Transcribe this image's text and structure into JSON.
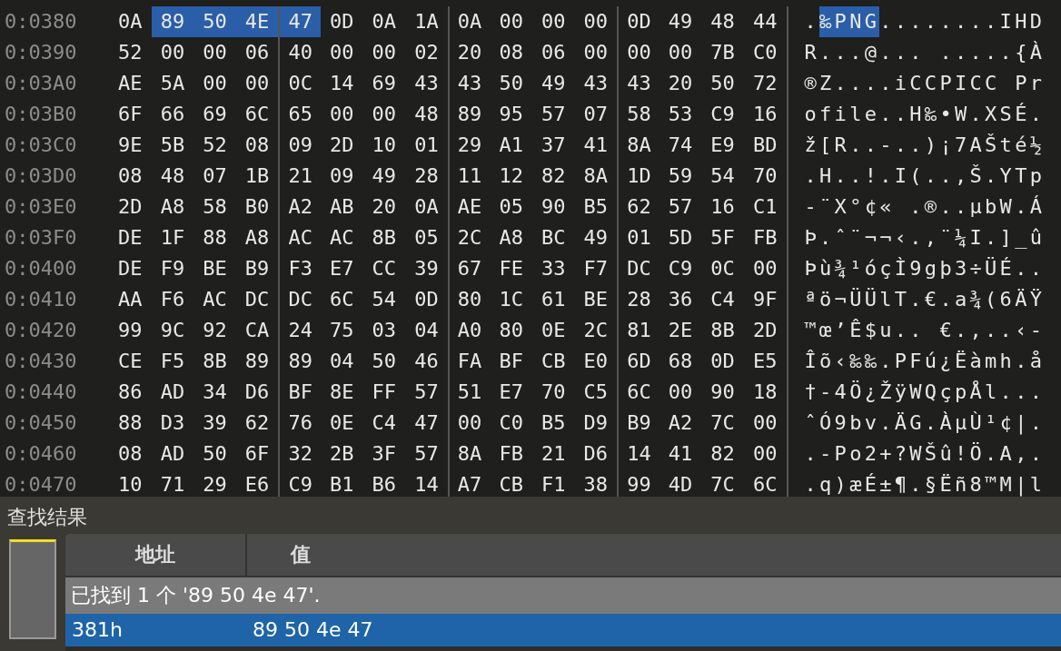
{
  "hex_view": {
    "rows": [
      {
        "offset": "0:0380",
        "bytes": [
          {
            "hex": "0A",
            "selected": false
          },
          {
            "hex": "89",
            "selected": true
          },
          {
            "hex": "50",
            "selected": true
          },
          {
            "hex": "4E",
            "selected": true
          },
          {
            "hex": "47",
            "selected": true
          },
          {
            "hex": "0D",
            "selected": false
          },
          {
            "hex": "0A",
            "selected": false
          },
          {
            "hex": "1A",
            "selected": false
          },
          {
            "hex": "0A",
            "selected": false
          },
          {
            "hex": "00",
            "selected": false
          },
          {
            "hex": "00",
            "selected": false
          },
          {
            "hex": "00",
            "selected": false
          },
          {
            "hex": "0D",
            "selected": false
          },
          {
            "hex": "49",
            "selected": false
          },
          {
            "hex": "48",
            "selected": false
          },
          {
            "hex": "44",
            "selected": false
          }
        ],
        "ascii": [
          {
            "text": ".",
            "selected": false
          },
          {
            "text": "‰PNG",
            "selected": true
          },
          {
            "text": "........IHD",
            "selected": false
          }
        ]
      },
      {
        "offset": "0:0390",
        "bytes": [
          {
            "hex": "52",
            "selected": false
          },
          {
            "hex": "00",
            "selected": false
          },
          {
            "hex": "00",
            "selected": false
          },
          {
            "hex": "06",
            "selected": false
          },
          {
            "hex": "40",
            "selected": false
          },
          {
            "hex": "00",
            "selected": false
          },
          {
            "hex": "00",
            "selected": false
          },
          {
            "hex": "02",
            "selected": false
          },
          {
            "hex": "20",
            "selected": false
          },
          {
            "hex": "08",
            "selected": false
          },
          {
            "hex": "06",
            "selected": false
          },
          {
            "hex": "00",
            "selected": false
          },
          {
            "hex": "00",
            "selected": false
          },
          {
            "hex": "00",
            "selected": false
          },
          {
            "hex": "7B",
            "selected": false
          },
          {
            "hex": "C0",
            "selected": false
          }
        ],
        "ascii": [
          {
            "text": "R...@... .....{À",
            "selected": false
          }
        ]
      },
      {
        "offset": "0:03A0",
        "bytes": [
          {
            "hex": "AE",
            "selected": false
          },
          {
            "hex": "5A",
            "selected": false
          },
          {
            "hex": "00",
            "selected": false
          },
          {
            "hex": "00",
            "selected": false
          },
          {
            "hex": "0C",
            "selected": false
          },
          {
            "hex": "14",
            "selected": false
          },
          {
            "hex": "69",
            "selected": false
          },
          {
            "hex": "43",
            "selected": false
          },
          {
            "hex": "43",
            "selected": false
          },
          {
            "hex": "50",
            "selected": false
          },
          {
            "hex": "49",
            "selected": false
          },
          {
            "hex": "43",
            "selected": false
          },
          {
            "hex": "43",
            "selected": false
          },
          {
            "hex": "20",
            "selected": false
          },
          {
            "hex": "50",
            "selected": false
          },
          {
            "hex": "72",
            "selected": false
          }
        ],
        "ascii": [
          {
            "text": "®Z....iCCPICC Pr",
            "selected": false
          }
        ]
      },
      {
        "offset": "0:03B0",
        "bytes": [
          {
            "hex": "6F",
            "selected": false
          },
          {
            "hex": "66",
            "selected": false
          },
          {
            "hex": "69",
            "selected": false
          },
          {
            "hex": "6C",
            "selected": false
          },
          {
            "hex": "65",
            "selected": false
          },
          {
            "hex": "00",
            "selected": false
          },
          {
            "hex": "00",
            "selected": false
          },
          {
            "hex": "48",
            "selected": false
          },
          {
            "hex": "89",
            "selected": false
          },
          {
            "hex": "95",
            "selected": false
          },
          {
            "hex": "57",
            "selected": false
          },
          {
            "hex": "07",
            "selected": false
          },
          {
            "hex": "58",
            "selected": false
          },
          {
            "hex": "53",
            "selected": false
          },
          {
            "hex": "C9",
            "selected": false
          },
          {
            "hex": "16",
            "selected": false
          }
        ],
        "ascii": [
          {
            "text": "ofile..H‰•W.XSÉ.",
            "selected": false
          }
        ]
      },
      {
        "offset": "0:03C0",
        "bytes": [
          {
            "hex": "9E",
            "selected": false
          },
          {
            "hex": "5B",
            "selected": false
          },
          {
            "hex": "52",
            "selected": false
          },
          {
            "hex": "08",
            "selected": false
          },
          {
            "hex": "09",
            "selected": false
          },
          {
            "hex": "2D",
            "selected": false
          },
          {
            "hex": "10",
            "selected": false
          },
          {
            "hex": "01",
            "selected": false
          },
          {
            "hex": "29",
            "selected": false
          },
          {
            "hex": "A1",
            "selected": false
          },
          {
            "hex": "37",
            "selected": false
          },
          {
            "hex": "41",
            "selected": false
          },
          {
            "hex": "8A",
            "selected": false
          },
          {
            "hex": "74",
            "selected": false
          },
          {
            "hex": "E9",
            "selected": false
          },
          {
            "hex": "BD",
            "selected": false
          }
        ],
        "ascii": [
          {
            "text": "ž[R..-..)¡7AŠté½",
            "selected": false
          }
        ]
      },
      {
        "offset": "0:03D0",
        "bytes": [
          {
            "hex": "08",
            "selected": false
          },
          {
            "hex": "48",
            "selected": false
          },
          {
            "hex": "07",
            "selected": false
          },
          {
            "hex": "1B",
            "selected": false
          },
          {
            "hex": "21",
            "selected": false
          },
          {
            "hex": "09",
            "selected": false
          },
          {
            "hex": "49",
            "selected": false
          },
          {
            "hex": "28",
            "selected": false
          },
          {
            "hex": "11",
            "selected": false
          },
          {
            "hex": "12",
            "selected": false
          },
          {
            "hex": "82",
            "selected": false
          },
          {
            "hex": "8A",
            "selected": false
          },
          {
            "hex": "1D",
            "selected": false
          },
          {
            "hex": "59",
            "selected": false
          },
          {
            "hex": "54",
            "selected": false
          },
          {
            "hex": "70",
            "selected": false
          }
        ],
        "ascii": [
          {
            "text": ".H..!.I(..,Š.YTp",
            "selected": false
          }
        ]
      },
      {
        "offset": "0:03E0",
        "bytes": [
          {
            "hex": "2D",
            "selected": false
          },
          {
            "hex": "A8",
            "selected": false
          },
          {
            "hex": "58",
            "selected": false
          },
          {
            "hex": "B0",
            "selected": false
          },
          {
            "hex": "A2",
            "selected": false
          },
          {
            "hex": "AB",
            "selected": false
          },
          {
            "hex": "20",
            "selected": false
          },
          {
            "hex": "0A",
            "selected": false
          },
          {
            "hex": "AE",
            "selected": false
          },
          {
            "hex": "05",
            "selected": false
          },
          {
            "hex": "90",
            "selected": false
          },
          {
            "hex": "B5",
            "selected": false
          },
          {
            "hex": "62",
            "selected": false
          },
          {
            "hex": "57",
            "selected": false
          },
          {
            "hex": "16",
            "selected": false
          },
          {
            "hex": "C1",
            "selected": false
          }
        ],
        "ascii": [
          {
            "text": "-¨X°¢« .®..µbW.Á",
            "selected": false
          }
        ]
      },
      {
        "offset": "0:03F0",
        "bytes": [
          {
            "hex": "DE",
            "selected": false
          },
          {
            "hex": "1F",
            "selected": false
          },
          {
            "hex": "88",
            "selected": false
          },
          {
            "hex": "A8",
            "selected": false
          },
          {
            "hex": "AC",
            "selected": false
          },
          {
            "hex": "AC",
            "selected": false
          },
          {
            "hex": "8B",
            "selected": false
          },
          {
            "hex": "05",
            "selected": false
          },
          {
            "hex": "2C",
            "selected": false
          },
          {
            "hex": "A8",
            "selected": false
          },
          {
            "hex": "BC",
            "selected": false
          },
          {
            "hex": "49",
            "selected": false
          },
          {
            "hex": "01",
            "selected": false
          },
          {
            "hex": "5D",
            "selected": false
          },
          {
            "hex": "5F",
            "selected": false
          },
          {
            "hex": "FB",
            "selected": false
          }
        ],
        "ascii": [
          {
            "text": "Þ.ˆ¨¬¬‹.,¨¼I.]_û",
            "selected": false
          }
        ]
      },
      {
        "offset": "0:0400",
        "bytes": [
          {
            "hex": "DE",
            "selected": false
          },
          {
            "hex": "F9",
            "selected": false
          },
          {
            "hex": "BE",
            "selected": false
          },
          {
            "hex": "B9",
            "selected": false
          },
          {
            "hex": "F3",
            "selected": false
          },
          {
            "hex": "E7",
            "selected": false
          },
          {
            "hex": "CC",
            "selected": false
          },
          {
            "hex": "39",
            "selected": false
          },
          {
            "hex": "67",
            "selected": false
          },
          {
            "hex": "FE",
            "selected": false
          },
          {
            "hex": "33",
            "selected": false
          },
          {
            "hex": "F7",
            "selected": false
          },
          {
            "hex": "DC",
            "selected": false
          },
          {
            "hex": "C9",
            "selected": false
          },
          {
            "hex": "0C",
            "selected": false
          },
          {
            "hex": "00",
            "selected": false
          }
        ],
        "ascii": [
          {
            "text": "Þù¾¹óçÌ9gþ3÷ÜÉ..",
            "selected": false
          }
        ]
      },
      {
        "offset": "0:0410",
        "bytes": [
          {
            "hex": "AA",
            "selected": false
          },
          {
            "hex": "F6",
            "selected": false
          },
          {
            "hex": "AC",
            "selected": false
          },
          {
            "hex": "DC",
            "selected": false
          },
          {
            "hex": "DC",
            "selected": false
          },
          {
            "hex": "6C",
            "selected": false
          },
          {
            "hex": "54",
            "selected": false
          },
          {
            "hex": "0D",
            "selected": false
          },
          {
            "hex": "80",
            "selected": false
          },
          {
            "hex": "1C",
            "selected": false
          },
          {
            "hex": "61",
            "selected": false
          },
          {
            "hex": "BE",
            "selected": false
          },
          {
            "hex": "28",
            "selected": false
          },
          {
            "hex": "36",
            "selected": false
          },
          {
            "hex": "C4",
            "selected": false
          },
          {
            "hex": "9F",
            "selected": false
          }
        ],
        "ascii": [
          {
            "text": "ªö¬ÜÜlT.€.a¾(6ÄŸ",
            "selected": false
          }
        ]
      },
      {
        "offset": "0:0420",
        "bytes": [
          {
            "hex": "99",
            "selected": false
          },
          {
            "hex": "9C",
            "selected": false
          },
          {
            "hex": "92",
            "selected": false
          },
          {
            "hex": "CA",
            "selected": false
          },
          {
            "hex": "24",
            "selected": false
          },
          {
            "hex": "75",
            "selected": false
          },
          {
            "hex": "03",
            "selected": false
          },
          {
            "hex": "04",
            "selected": false
          },
          {
            "hex": "A0",
            "selected": false
          },
          {
            "hex": "80",
            "selected": false
          },
          {
            "hex": "0E",
            "selected": false
          },
          {
            "hex": "2C",
            "selected": false
          },
          {
            "hex": "81",
            "selected": false
          },
          {
            "hex": "2E",
            "selected": false
          },
          {
            "hex": "8B",
            "selected": false
          },
          {
            "hex": "2D",
            "selected": false
          }
        ],
        "ascii": [
          {
            "text": "™œ’Ê$u.. €.,..‹-",
            "selected": false
          }
        ]
      },
      {
        "offset": "0:0430",
        "bytes": [
          {
            "hex": "CE",
            "selected": false
          },
          {
            "hex": "F5",
            "selected": false
          },
          {
            "hex": "8B",
            "selected": false
          },
          {
            "hex": "89",
            "selected": false
          },
          {
            "hex": "89",
            "selected": false
          },
          {
            "hex": "04",
            "selected": false
          },
          {
            "hex": "50",
            "selected": false
          },
          {
            "hex": "46",
            "selected": false
          },
          {
            "hex": "FA",
            "selected": false
          },
          {
            "hex": "BF",
            "selected": false
          },
          {
            "hex": "CB",
            "selected": false
          },
          {
            "hex": "E0",
            "selected": false
          },
          {
            "hex": "6D",
            "selected": false
          },
          {
            "hex": "68",
            "selected": false
          },
          {
            "hex": "0D",
            "selected": false
          },
          {
            "hex": "E5",
            "selected": false
          }
        ],
        "ascii": [
          {
            "text": "Îõ‹‰‰.PFú¿Ëàmh.å",
            "selected": false
          }
        ]
      },
      {
        "offset": "0:0440",
        "bytes": [
          {
            "hex": "86",
            "selected": false
          },
          {
            "hex": "AD",
            "selected": false
          },
          {
            "hex": "34",
            "selected": false
          },
          {
            "hex": "D6",
            "selected": false
          },
          {
            "hex": "BF",
            "selected": false
          },
          {
            "hex": "8E",
            "selected": false
          },
          {
            "hex": "FF",
            "selected": false
          },
          {
            "hex": "57",
            "selected": false
          },
          {
            "hex": "51",
            "selected": false
          },
          {
            "hex": "E7",
            "selected": false
          },
          {
            "hex": "70",
            "selected": false
          },
          {
            "hex": "C5",
            "selected": false
          },
          {
            "hex": "6C",
            "selected": false
          },
          {
            "hex": "00",
            "selected": false
          },
          {
            "hex": "90",
            "selected": false
          },
          {
            "hex": "18",
            "selected": false
          }
        ],
        "ascii": [
          {
            "text": "†-4Ö¿ŽÿWQçpÅl...",
            "selected": false
          }
        ]
      },
      {
        "offset": "0:0450",
        "bytes": [
          {
            "hex": "88",
            "selected": false
          },
          {
            "hex": "D3",
            "selected": false
          },
          {
            "hex": "39",
            "selected": false
          },
          {
            "hex": "62",
            "selected": false
          },
          {
            "hex": "76",
            "selected": false
          },
          {
            "hex": "0E",
            "selected": false
          },
          {
            "hex": "C4",
            "selected": false
          },
          {
            "hex": "47",
            "selected": false
          },
          {
            "hex": "00",
            "selected": false
          },
          {
            "hex": "C0",
            "selected": false
          },
          {
            "hex": "B5",
            "selected": false
          },
          {
            "hex": "D9",
            "selected": false
          },
          {
            "hex": "B9",
            "selected": false
          },
          {
            "hex": "A2",
            "selected": false
          },
          {
            "hex": "7C",
            "selected": false
          },
          {
            "hex": "00",
            "selected": false
          }
        ],
        "ascii": [
          {
            "text": "ˆÓ9bv.ÄG.ÀµÙ¹¢|.",
            "selected": false
          }
        ]
      },
      {
        "offset": "0:0460",
        "bytes": [
          {
            "hex": "08",
            "selected": false
          },
          {
            "hex": "AD",
            "selected": false
          },
          {
            "hex": "50",
            "selected": false
          },
          {
            "hex": "6F",
            "selected": false
          },
          {
            "hex": "32",
            "selected": false
          },
          {
            "hex": "2B",
            "selected": false
          },
          {
            "hex": "3F",
            "selected": false
          },
          {
            "hex": "57",
            "selected": false
          },
          {
            "hex": "8A",
            "selected": false
          },
          {
            "hex": "FB",
            "selected": false
          },
          {
            "hex": "21",
            "selected": false
          },
          {
            "hex": "D6",
            "selected": false
          },
          {
            "hex": "14",
            "selected": false
          },
          {
            "hex": "41",
            "selected": false
          },
          {
            "hex": "82",
            "selected": false
          },
          {
            "hex": "00",
            "selected": false
          }
        ],
        "ascii": [
          {
            "text": ".-Po2+?WŠû!Ö.A,.",
            "selected": false
          }
        ]
      },
      {
        "offset": "0:0470",
        "bytes": [
          {
            "hex": "10",
            "selected": false
          },
          {
            "hex": "71",
            "selected": false
          },
          {
            "hex": "29",
            "selected": false
          },
          {
            "hex": "E6",
            "selected": false
          },
          {
            "hex": "C9",
            "selected": false
          },
          {
            "hex": "B1",
            "selected": false
          },
          {
            "hex": "B6",
            "selected": false
          },
          {
            "hex": "14",
            "selected": false
          },
          {
            "hex": "A7",
            "selected": false
          },
          {
            "hex": "CB",
            "selected": false
          },
          {
            "hex": "F1",
            "selected": false
          },
          {
            "hex": "38",
            "selected": false
          },
          {
            "hex": "99",
            "selected": false
          },
          {
            "hex": "4D",
            "selected": false
          },
          {
            "hex": "7C",
            "selected": false
          },
          {
            "hex": "6C",
            "selected": false
          }
        ],
        "ascii": [
          {
            "text": ".q)æÉ±¶.§Ëñ8™M|l",
            "selected": false
          }
        ]
      }
    ]
  },
  "search_results": {
    "title": "查找结果",
    "columns": [
      "地址",
      "值"
    ],
    "summary": "已找到 1 个 '89 50 4e 47'.",
    "rows": [
      {
        "address": "381h",
        "value": "89 50 4e 47",
        "selected": true
      }
    ]
  }
}
